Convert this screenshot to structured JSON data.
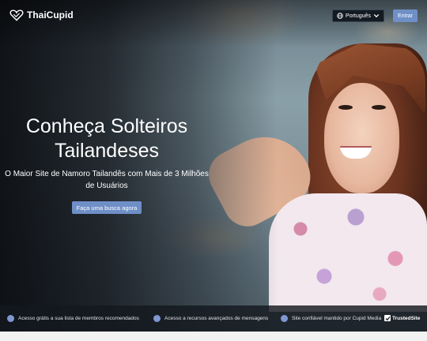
{
  "header": {
    "logo_text": "ThaiCupid",
    "language_label": "Português",
    "login_label": "Entrar"
  },
  "hero": {
    "headline": "Conheça Solteiros Tailandeses",
    "subheadline": "O Maior Site de Namoro Tailandês com Mais de 3 Milhões de Usuários",
    "cta_label": "Faça uma busca agora"
  },
  "features": {
    "items": [
      "Acesso grátis a sua lista de membros recomendados",
      "Acesso a recursos avançados de mensagens",
      "Site confiável mantido por Cupid Media"
    ],
    "badge": "TrustedSite"
  },
  "colors": {
    "accent": "#6f8fc7",
    "header_button_bg": "#141a22",
    "features_bar_bg": "#14181e"
  },
  "icons": [
    "heart-logo-icon",
    "globe-icon",
    "chevron-down-icon",
    "check-icon"
  ]
}
